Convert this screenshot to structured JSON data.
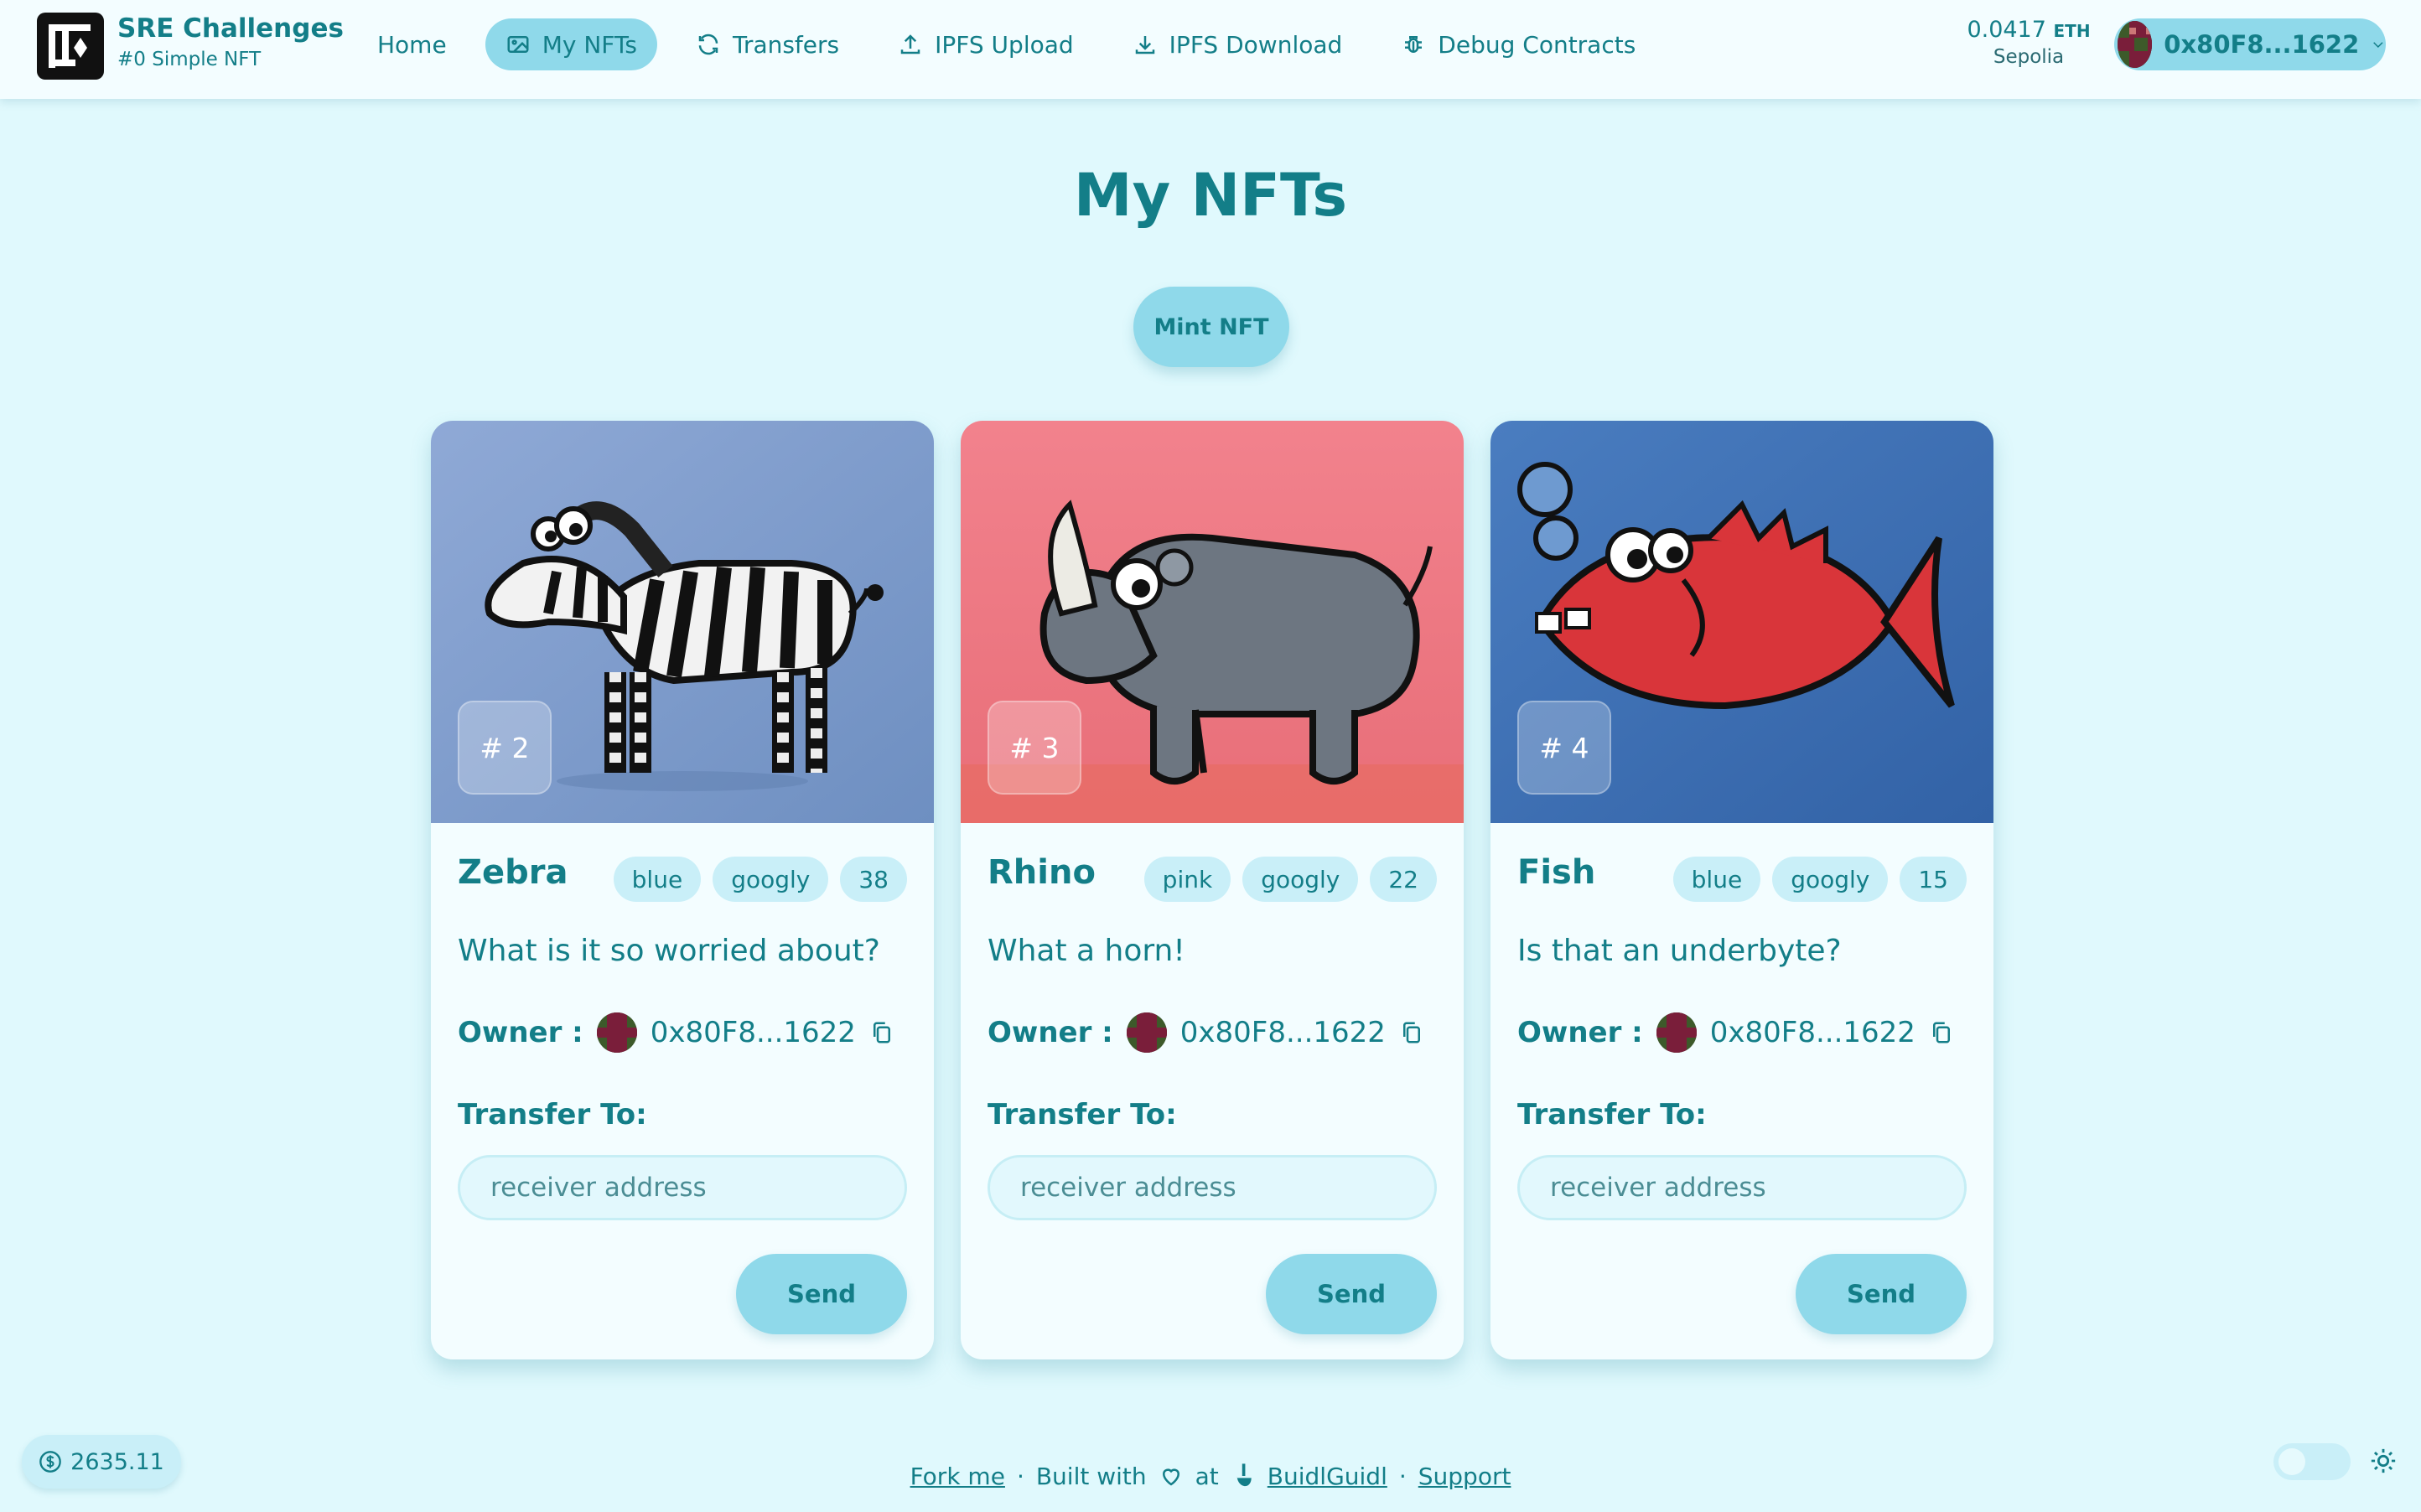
{
  "brand": {
    "title": "SRE Challenges",
    "subtitle": "#0 Simple NFT"
  },
  "nav": [
    {
      "label": "Home",
      "icon": "none",
      "active": false
    },
    {
      "label": "My NFTs",
      "icon": "image-icon",
      "active": true
    },
    {
      "label": "Transfers",
      "icon": "refresh-icon",
      "active": false
    },
    {
      "label": "IPFS Upload",
      "icon": "upload-icon",
      "active": false
    },
    {
      "label": "IPFS Download",
      "icon": "download-icon",
      "active": false
    },
    {
      "label": "Debug Contracts",
      "icon": "bug-icon",
      "active": false
    }
  ],
  "wallet": {
    "balance": "0.0417",
    "unit": "ETH",
    "network": "Sepolia",
    "address": "0x80F8...1622"
  },
  "page": {
    "title": "My NFTs",
    "mint_label": "Mint NFT"
  },
  "cards": [
    {
      "id": "# 2",
      "name": "Zebra",
      "chips": [
        "blue",
        "googly",
        "38"
      ],
      "description": "What is it so worried about?",
      "owner_label": "Owner :",
      "owner": "0x80F8...1622",
      "transfer_label": "Transfer To:",
      "placeholder": "receiver address",
      "send_label": "Send",
      "bg_color": "#7d9fcd"
    },
    {
      "id": "# 3",
      "name": "Rhino",
      "chips": [
        "pink",
        "googly",
        "22"
      ],
      "description": "What a horn!",
      "owner_label": "Owner :",
      "owner": "0x80F8...1622",
      "transfer_label": "Transfer To:",
      "placeholder": "receiver address",
      "send_label": "Send",
      "bg_color": "#ee7b86"
    },
    {
      "id": "# 4",
      "name": "Fish",
      "chips": [
        "blue",
        "googly",
        "15"
      ],
      "description": "Is that an underbyte?",
      "owner_label": "Owner :",
      "owner": "0x80F8...1622",
      "transfer_label": "Transfer To:",
      "placeholder": "receiver address",
      "send_label": "Send",
      "bg_color": "#3a6db0"
    }
  ],
  "footer": {
    "price": "2635.11",
    "fork": "Fork me",
    "sep": "·",
    "built": "Built with",
    "at": "at",
    "buidl": "BuidlGuidl",
    "support": "Support"
  },
  "colors": {
    "primary": "#8fd9ea",
    "text": "#137e88",
    "background": "#e0f9fd"
  }
}
